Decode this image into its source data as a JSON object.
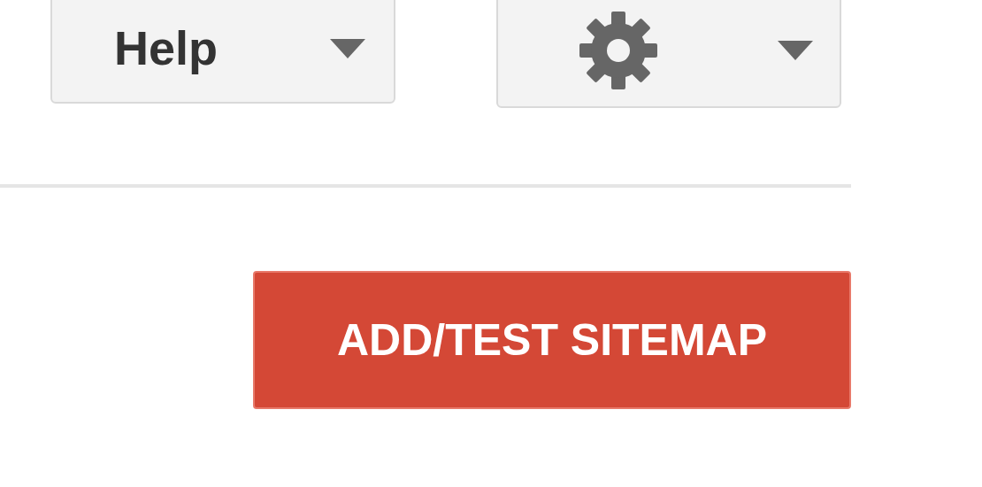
{
  "toolbar": {
    "help_button": {
      "label": "Help"
    }
  },
  "add_sitemap_button": {
    "label": "ADD/TEST SITEMAP"
  }
}
